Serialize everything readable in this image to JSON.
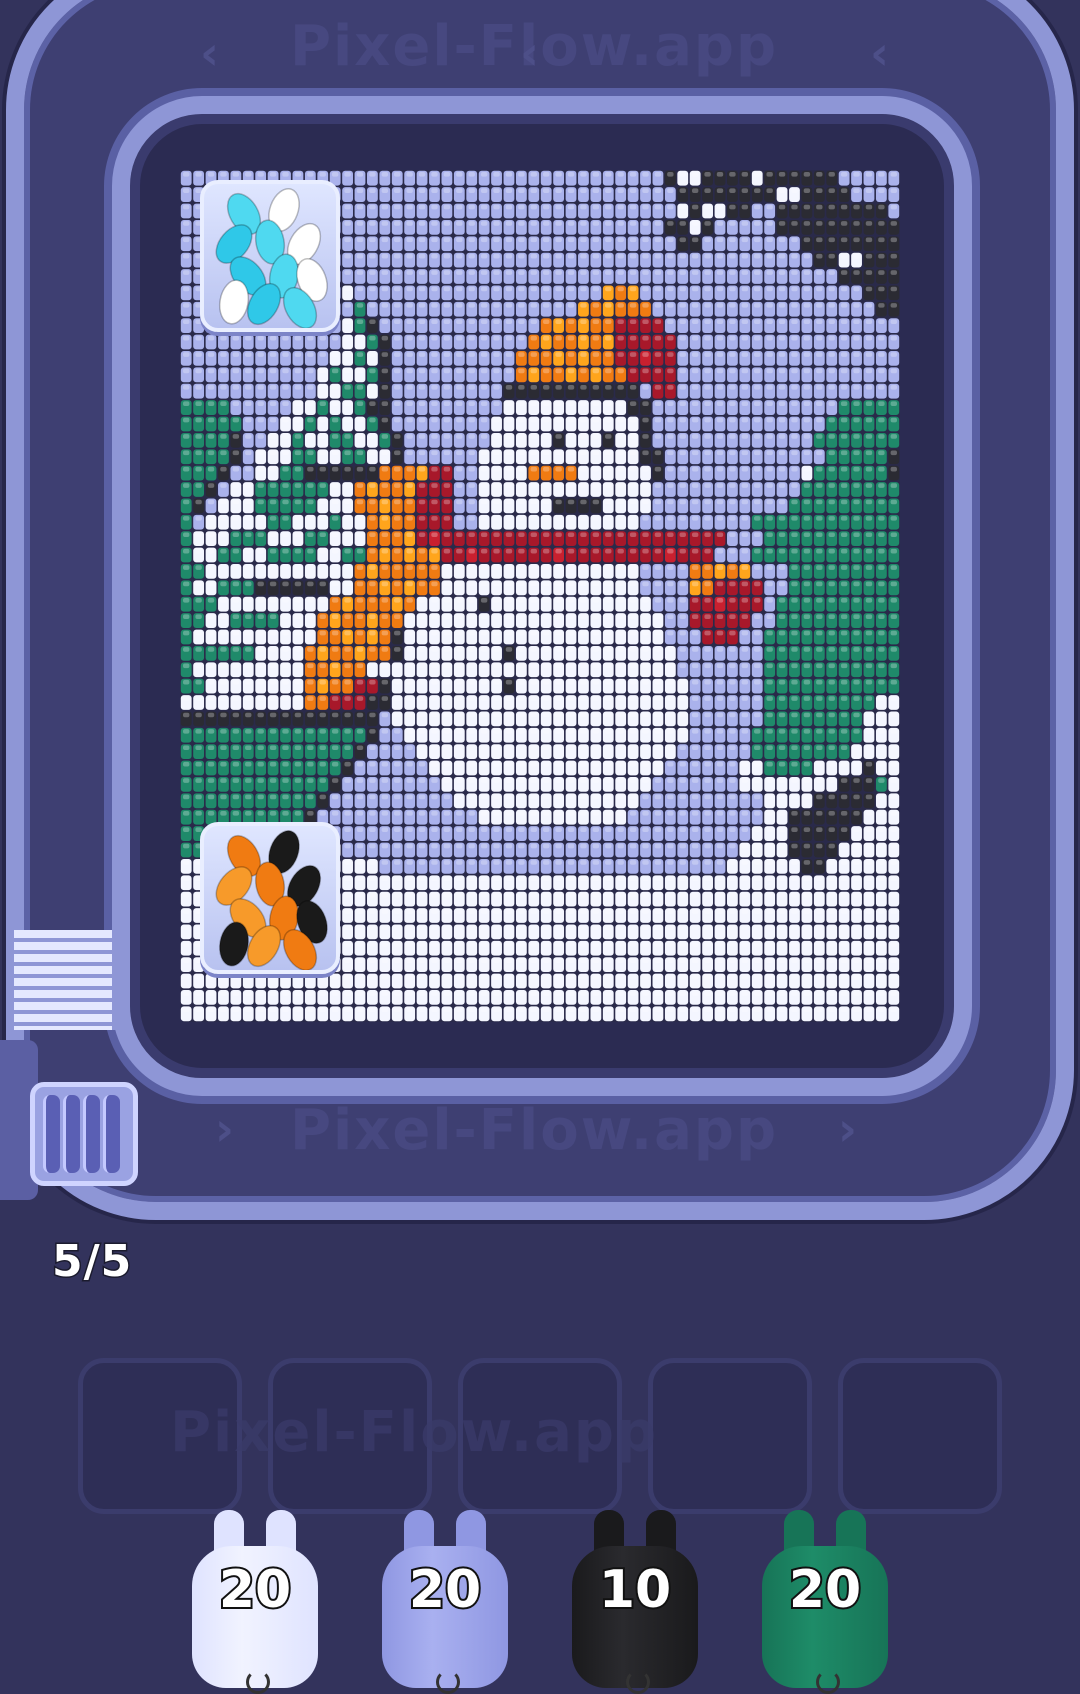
{
  "watermark": {
    "top": "Pixel-Flow.app",
    "bottom": "Pixel-Flow.app",
    "left": "Pixel-Flow.app",
    "right": "Pixel-Flow.app",
    "center": "Pixel-Flow.app",
    "slots": "Pixel-Flow.app"
  },
  "ammo_counter": "5/5",
  "palette": {
    "W": "#f4f6ff",
    "L": "#aab2ec",
    "P": "#c7ccf6",
    "G": "#1f8a6a",
    "g": "#2aa37c",
    "K": "#2b2b33",
    "O": "#f07b12",
    "o": "#ffa51c",
    "R": "#a8182a",
    "r": "#c9202f",
    "S": "#8a8ec2"
  },
  "board_rows": [
    "LLLLLLLLLLLLLLLLLLLLLLLLLLLLLLLLLLLLLLLKWWKKKKWKKKKKKLLLLL",
    "LLLLLLLLLLLLLLLLLLLLLLLLLLLLLLLLLLLLLLLLKKKKKKKKWWKKKKLLLL",
    "LLLLLLLLLLLLLLLLLLLLLLLLLLLLLLLLLLLLLLLLWKWWKKLLKKKKKKKKKL",
    "LLLLLLLLLLLLLLLLLLLLLLLLLLLLLLLLLLLLLLLKKWKLLLLLKKKKKKKKKK",
    "LLLLLLLLLLLLLLLLLLLLLLLLLLLLLLLLLLLLLLLLKKLLLLLLLLKKKKKKKK",
    "LLLLLLLLLLLLLLLLLLLLLLLLLLLLLLLLLLLLLLLLLLLLLLLLLLLKKWWKKK",
    "LLLLLLLLLLLLLLLLLLLLLLLLLLLLLLLLLLLLLLLLLLLLLLLLLLLLLKKKKK",
    "LLLLLLLLLLLLLWLLLLLLLLLLLLLLLLLLLLoOoLLLLLLLLLLLLLLLLLLKKK",
    "LLLLLLLLLLLLLLGLLLLLLLLLLLLLLLLLoOoOOOLLLLLLLLLLLLLLLLLLKK",
    "LLLLLLLLLLLLLWGKLLLLLLLLLLLLLOoOoOORRRRLLLLLLLLLLLLLLLLLLL",
    "LLLLLLLLLLLLLWWGKLLLLLLLLLLLOoOOoOoRRRRRLLLLLLLLLLLLLLLLLL",
    "LLLLLLLLLLLLWWGWKLLLLLLLLLLOOOoOoOORRrRRLLLLLLLLLLLLLLLLLL",
    "LLLLLLLLLLLWGWWGKLLLLLLLLLLOoOOoOoOORRRRLLLLLLLLLLLLLLLLLL",
    "LLLLLLLLLLLWWGGWKLLLLLLLLLKKKKKKKKKKKLRRLLLLLLLLLLLLLLLLLL",
    "GGGGLLLLLWWGWWGKKLLLLLLLLLWWWWWWWWWWKKLLLLLLLLLLLLLLLGGGGG",
    "GGGGGLLLWWGWGWWGKLLLLLLLLWWWWWWWWWWWWKLLLLLLLLLLLLLLGGGGGG",
    "GGGGKLLWWGWWGGWWGKLLLLLLLWWWWWKWWWKWWKLLLLLLLLLLLLLGGGGGGG",
    "GGGGKLWWWGGWWGGWWKLLLLLLWWWWWWWWWWWWWKKLLLLLLLLLLLLLGGGGGK",
    "GGGKLLWWGGKKKKKKOOOoRRLLWWWWOOOOWWWWWWKLLLLLLLLLLLWGGGGGGK",
    "GGKLWWGGGGGGWWOoOOoRRRLLWWWWWWWWWWWWWWLLLLLLLLLLLLGGGGGGGG",
    "GKLWWWGGGGGWWWOOoOORRRLLWWWWWWKKKKWWWWLLLLLLLLLLLGGGGGGGGG",
    "GLWWWWWGGWWWGWWOoOORRRLLWWWWWWWWWWWWWLLLLLLLLLGGGGGGGGGGGG",
    "GWWWGGGWWWGGWWWOOOoRrRRRRRRRRRRRRRRRRRRRRRRRLLLGGGGGGGGGGG",
    "GWWGGWWGGGGWWGGOoOoOoRRrRRRRRRrRRRRRRRRrRRRLLLGGGGGGGGGGGG",
    "GGWWWWWWWWWWWWOoOOOOOWWWWWWWWWWWWWWWWLLLLOOoOoLLLGGGGGGGGG",
    "GWWGGGKKKKKKWWOOoOoOOWWWWWWWWWWWWWWWWLLLLoORRRRLLGGGGGGGGG",
    "GGGWWWWWWWWWOoOOOoOWWWWWKWWWWWWWWWWWWWLLLRRrRRRLGGGGGGGGGG",
    "GGWWGGGGWWWOoOOoOOWWWWWWWWWWWWWWWWWWWWWLLRRRRRLLGGGGGGGGGG",
    "GWWWWWWWWWWOOoOoOKWWWWWWWWWWWWWWWWWWWWWLLLRRRLLGGGGGGGGGGG",
    "GGGGGGWWWWOoOOoOOKWWWWWWWWKWWWWWWWWWWWWWLLLLLLLGGGGGGGGGGG",
    "GWWWWWWWWWOOoOOWWWWWWWWWWWWWWWWWWWWWWWWWLLLLLLLGGGGGGGGGGG",
    "GGWWWWWWWWOoOORRKWWWWWWWWWKWWWWWWWWWWWWWWLLLLLLGGGGGGGGGGG",
    "WWWWWWWWWWOORRRKKWWWWWWWWWWWWWWWWWWWWWWWWLLLLLLGGGGGGGGGWW",
    "KKKKKKKKKKKKKKKKLWWWWWWWWWWWWWWWWWWWWWWWWLLLLLLGGGGGGGGWWW",
    "GGGGGGGGGGGGGGGKLLWWWWWWWWWWWWWWWWWWWWWWWLLLLLGGGGGGGGGWWW",
    "GGGGGGGGGGGGGGKLLLLWWWWWWWWWWWWWWWWWWWWWLLLLLLGGGGGGGGWWWW",
    "GGGGGGGGGGGGGKLLLLLLWWWWWWWWWWWWWWWWWWWLLLLLLWWGGGGWWWWKWW",
    "GGGGGGGGGGGGKLLLLLLLLWWWWWWWWWWWWWWWWWLLLLLLLWWWWWWWWKKKGW",
    "GGGGGGGGGGGKLLLLLLLLLLWWWWWWWWWWWWWWWLLLLLLLLLLWWWWKKKKKWW",
    "GGGGGGGGGGKLLLLLLLLLLLLLWWWWWWWWWWWWLLLLLLLLLLLWWKKKKKKWWW",
    "GGGGGGGGGKLLLLLLLLLLLLLLLLLLLLLLLLLLLLLLLLLLLLWWWKKKKKWWWW",
    "GGGGGGGGKWWWWLLLLLLLLLLLLLLLLLLLLLLLLLLLLLLLLWWWWKKKKWWWWW",
    "WWWWWWWWWWWWWWWWLLLLLLLLLLLLLLLLLLLLLLLLLLLLWWWWWWKKWWWWWW",
    "WWWWWWWWWWWWWWWWWWWWWWWWWWWWWWWWWWWWWWWWWWWWWWWWWWWWWWWWWW",
    "WWWWWWWWWWWWWWWWWWWWWWWWWWWWWWWWWWWWWWWWWWWWWWWWWWWWWWWWWW",
    "WWWWWWWWWWWWWWWWWWWWWWWWWWWWWWWWWWWWWWWWWWWWWWWWWWWWWWWWWW",
    "WWWWWWWWWWWWWWWWWWWWWWWWWWWWWWWWWWWWWWWWWWWWWWWWWWWWWWWWWW",
    "WWWWWWWWWWWWWWWWWWWWWWWWWWWWWWWWWWWWWWWWWWWWWWWWWWWWWWWWWW",
    "WWWWWWWWWWWWWWWWWWWWWWWWWWWWWWWWWWWWWWWWWWWWWWWWWWWWWWWWWW",
    "WWWWWWWWWWWWWWWWWWWWWWWWWWWWWWWWWWWWWWWWWWWWWWWWWWWWWWWWWW",
    "WWWWWWWWWWWWWWWWWWWWWWWWWWWWWWWWWWWWWWWWWWWWWWWWWWWWWWWWWW",
    "WWWWWWWWWWWWWWWWWWWWWWWWWWWWWWWWWWWWWWWWWWWWWWWWWWWWWWWWWW"
  ],
  "ice_boxes": [
    {
      "name": "ice-box-top",
      "bead_colors": [
        "#4fd9f0",
        "#ffffff",
        "#2fc8e8"
      ]
    },
    {
      "name": "ice-box-bottom",
      "bead_colors": [
        "#f07b12",
        "#1a1a1a",
        "#f79a2a"
      ]
    }
  ],
  "slots_count": 5,
  "shooters": [
    {
      "name": "shooter-white",
      "count": "20",
      "color": "#f1f3ff",
      "ear": "#dfe3ff"
    },
    {
      "name": "shooter-lavender",
      "count": "20",
      "color": "#a9b0f0",
      "ear": "#8f97e2"
    },
    {
      "name": "shooter-black",
      "count": "10",
      "color": "#2a2a2e",
      "ear": "#1a1a1c"
    },
    {
      "name": "shooter-green",
      "count": "20",
      "color": "#1e8c68",
      "ear": "#177457"
    }
  ]
}
